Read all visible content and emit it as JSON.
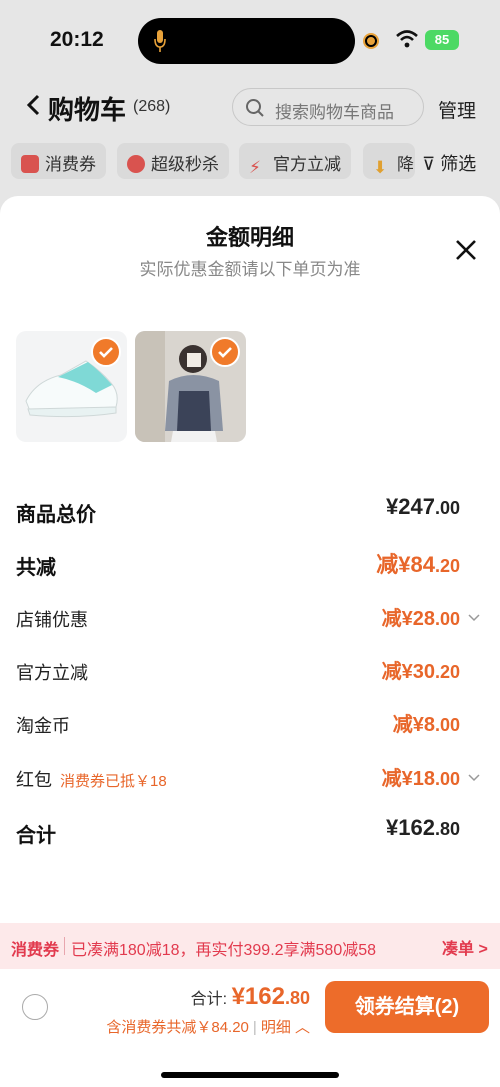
{
  "status": {
    "time": "20:12",
    "battery": "85"
  },
  "header": {
    "title": "购物车",
    "count": "(268)",
    "search_placeholder": "搜索购物车商品",
    "manage": "管理"
  },
  "filters": {
    "chips": [
      "消费券",
      "超级秒杀",
      "官方立减",
      "降"
    ],
    "filter_label": "筛选"
  },
  "sheet": {
    "title": "金额明细",
    "subtitle": "实际优惠金额请以下单页为准",
    "items": [
      {
        "name": "white-teal running shoe",
        "checked": true
      },
      {
        "name": "blue cardigan outfit",
        "checked": true
      }
    ],
    "rows": {
      "goods_total": {
        "label": "商品总价",
        "value_main": "¥247",
        "value_cents": ".00"
      },
      "total_reduce": {
        "label": "共减",
        "value_main": "减¥84",
        "value_cents": ".20"
      },
      "shop_discount": {
        "label": "店铺优惠",
        "value_main": "减¥28",
        "value_cents": ".00"
      },
      "official_reduce": {
        "label": "官方立减",
        "value_main": "减¥30",
        "value_cents": ".20"
      },
      "taojinbi": {
        "label": "淘金币",
        "value_main": "减¥8",
        "value_cents": ".00"
      },
      "red_packet": {
        "label": "红包",
        "note": "消费券已抵￥18",
        "value_main": "减¥18",
        "value_cents": ".00"
      },
      "sum": {
        "label": "合计",
        "value_main": "¥162",
        "value_cents": ".80"
      }
    }
  },
  "promo": {
    "label": "消费券",
    "text": "已凑满180减18，再实付399.2享满580减58",
    "cta": "凑单 >"
  },
  "checkout": {
    "total_label": "合计: ",
    "total_main": "¥162",
    "total_cents": ".80",
    "discount_text": "含消费券共减￥84.20",
    "detail_label": "明细",
    "pay_button": "领券结算(2)"
  },
  "colors": {
    "accent": "#ed6c2a",
    "promo_red": "#e23a4e"
  }
}
